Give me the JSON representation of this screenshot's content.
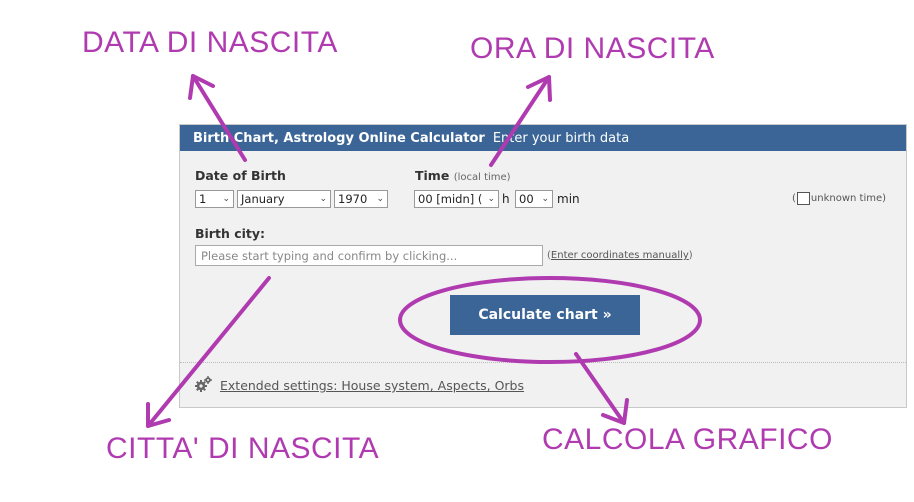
{
  "annotations": {
    "birth_date": "DATA DI NASCITA",
    "birth_time": "ORA DI NASCITA",
    "birth_city": "CITTA' DI NASCITA",
    "calculate": "CALCOLA GRAFICO"
  },
  "colors": {
    "annotation": "#b03bb0",
    "header": "#3a6596",
    "button": "#3a6596",
    "panel": "#f1f1f1"
  },
  "form": {
    "title": "Birth Chart, Astrology Online Calculator",
    "subtitle": "Enter your birth data",
    "date": {
      "label": "Date of Birth",
      "day": "1",
      "month": "January",
      "year": "1970"
    },
    "time": {
      "label": "Time",
      "note": "(local time)",
      "hour": "00 [midn] (",
      "hour_unit": "h",
      "minute": "00",
      "minute_unit": "min",
      "unknown_open": "(",
      "unknown_label": "unknown time)"
    },
    "city": {
      "label": "Birth city:",
      "placeholder": "Please start typing and confirm by clicking...",
      "coords_open": "(",
      "coords_link": "Enter coordinates manually",
      "coords_close": ")"
    },
    "calculate_label": "Calculate chart »",
    "extended_label": "Extended settings: House system, Aspects, Orbs",
    "icons": {
      "select": "chevron-down-icon",
      "extended": "gear-icon"
    }
  }
}
